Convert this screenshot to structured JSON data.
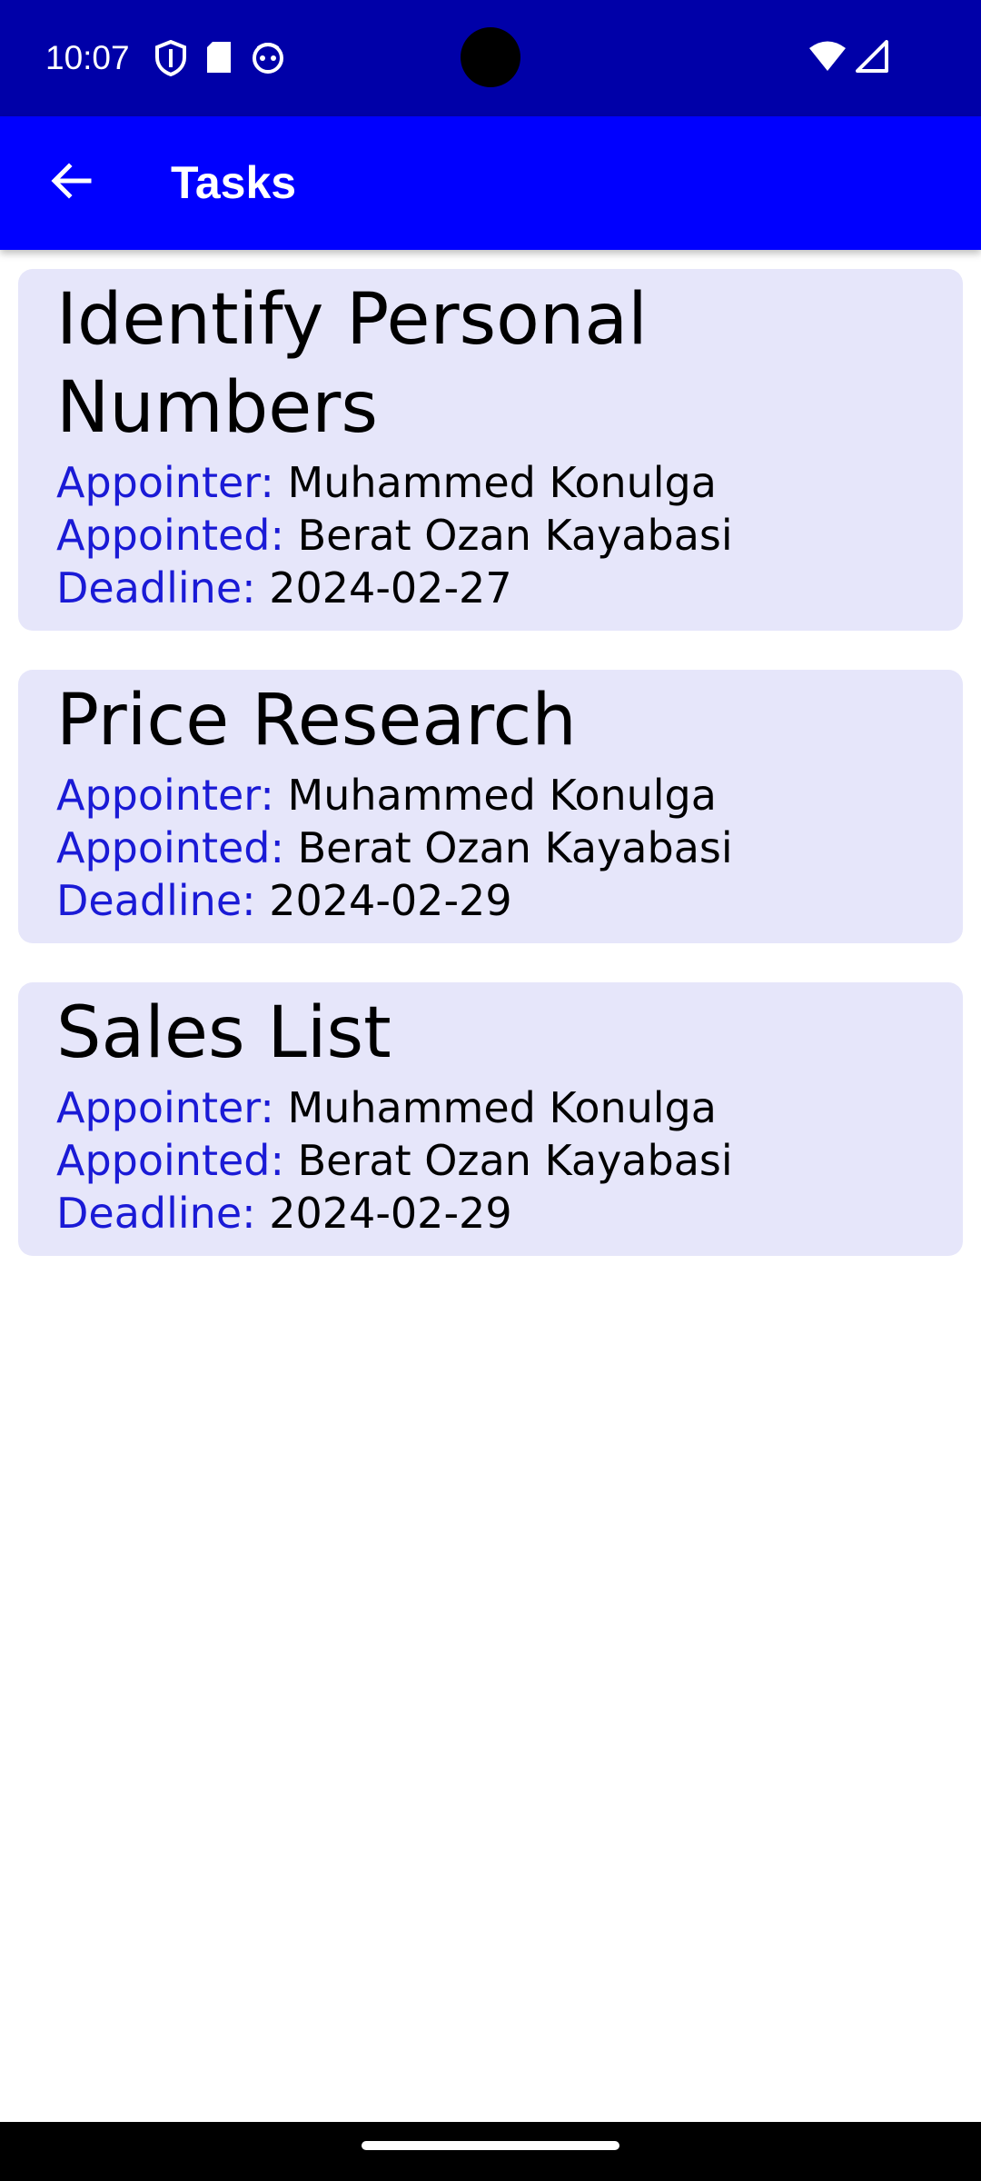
{
  "status_bar": {
    "time": "10:07",
    "icons_left": [
      "shield-icon",
      "sd-card-icon",
      "face-icon"
    ],
    "icons_right": [
      "wifi-icon",
      "cell-signal-icon"
    ]
  },
  "app_bar": {
    "title": "Tasks",
    "back_icon": "arrow-back-icon"
  },
  "tasks": [
    {
      "title": "Identify Personal Numbers",
      "appointer_label": "Appointer:",
      "appointer": "Muhammed Konulga",
      "appointed_label": "Appointed:",
      "appointed": "Berat Ozan Kayabasi",
      "deadline_label": "Deadline:",
      "deadline": "2024-02-27"
    },
    {
      "title": "Price Research",
      "appointer_label": "Appointer:",
      "appointer": "Muhammed Konulga",
      "appointed_label": "Appointed:",
      "appointed": "Berat Ozan Kayabasi",
      "deadline_label": "Deadline:",
      "deadline": "2024-02-29"
    },
    {
      "title": "Sales List",
      "appointer_label": "Appointer:",
      "appointer": "Muhammed Konulga",
      "appointed_label": "Appointed:",
      "appointed": "Berat Ozan Kayabasi",
      "deadline_label": "Deadline:",
      "deadline": "2024-02-29"
    }
  ],
  "colors": {
    "status_bar": "#0000a8",
    "app_bar": "#0000ff",
    "card_background": "#e6e6fa",
    "label_color": "#1a1ad6"
  }
}
